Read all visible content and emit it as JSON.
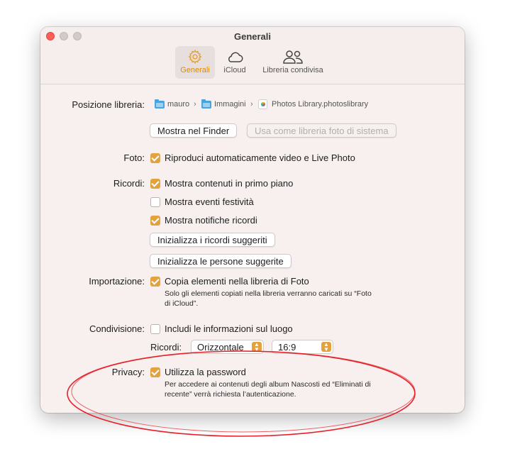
{
  "window": {
    "title": "Generali",
    "tabs": [
      {
        "label": "Generali",
        "icon": "gear-icon",
        "active": true
      },
      {
        "label": "iCloud",
        "icon": "cloud-icon",
        "active": false
      },
      {
        "label": "Libreria condivisa",
        "icon": "people-icon",
        "active": false
      }
    ]
  },
  "library": {
    "label": "Posizione libreria:",
    "path": [
      "mauro",
      "Immagini",
      "Photos Library.photoslibrary"
    ],
    "show_in_finder": "Mostra nel Finder",
    "use_as_system": "Usa come libreria foto di sistema"
  },
  "photos": {
    "label": "Foto:",
    "autoplay": {
      "label": "Riproduci automaticamente video e Live Photo",
      "checked": true
    }
  },
  "memories": {
    "label": "Ricordi:",
    "options": [
      {
        "label": "Mostra contenuti in primo piano",
        "checked": true
      },
      {
        "label": "Mostra eventi festività",
        "checked": false
      },
      {
        "label": "Mostra notifiche ricordi",
        "checked": true
      }
    ],
    "reset_memories": "Inizializza i ricordi suggeriti",
    "reset_people": "Inizializza le persone suggerite"
  },
  "importing": {
    "label": "Importazione:",
    "copy": {
      "label": "Copia elementi nella libreria di Foto",
      "checked": true
    },
    "note_line1": "Solo gli elementi copiati nella libreria verranno caricati su “Foto",
    "note_line2": "di iCloud”."
  },
  "sharing": {
    "label": "Condivisione:",
    "location": {
      "label": "Includi le informazioni sul luogo",
      "checked": false
    },
    "memories_label": "Ricordi:",
    "orientation": "Orizzontale",
    "ratio": "16:9"
  },
  "privacy": {
    "label": "Privacy:",
    "password": {
      "label": "Utilizza la password",
      "checked": true
    },
    "note_line1": "Per accedere ai contenuti degli album Nascosti ed “Eliminati di",
    "note_line2": "recente” verrà richiesta l’autenticazione."
  },
  "colors": {
    "accent": "#e3a23b",
    "annotation": "#e8202a",
    "close": "#ff5f57"
  }
}
